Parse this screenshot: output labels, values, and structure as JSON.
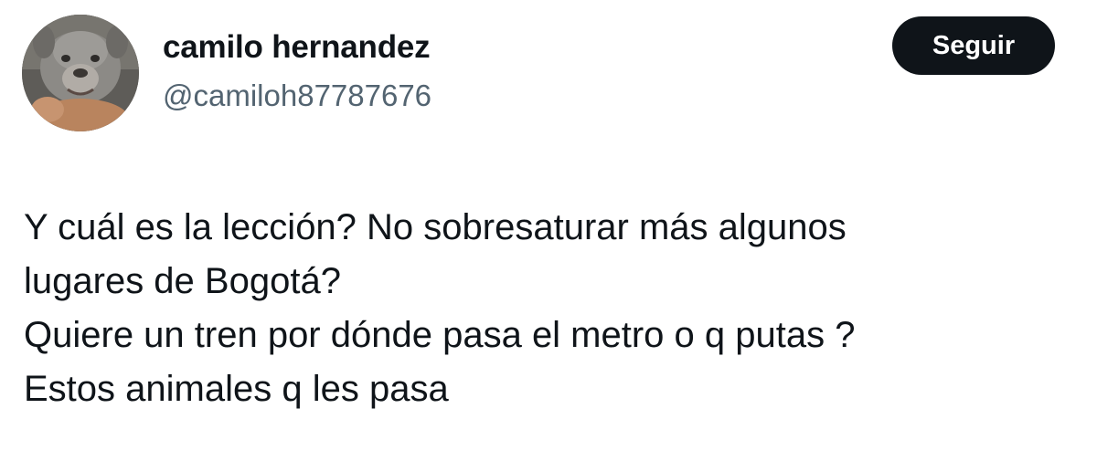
{
  "user": {
    "display_name": "camilo hernandez",
    "handle": "@camiloh87787676",
    "avatar_icon": "dog-avatar-photo"
  },
  "follow_button": {
    "label": "Seguir"
  },
  "tweet": {
    "lines": [
      "Y cuál es la lección? No sobresaturar más algunos",
      "lugares de Bogotá?",
      "Quiere un tren por dónde pasa el metro o q putas ?",
      "Estos animales q les pasa"
    ]
  },
  "colors": {
    "text_primary": "#0f1419",
    "text_secondary": "#536471",
    "button_bg": "#0f1419",
    "button_text": "#ffffff",
    "background": "#ffffff"
  }
}
